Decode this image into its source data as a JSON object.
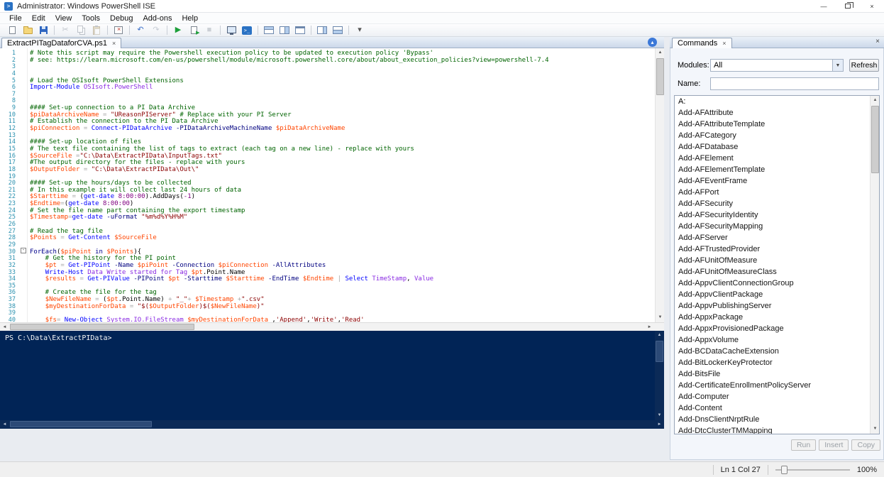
{
  "window": {
    "title": "Administrator: Windows PowerShell ISE",
    "controls": {
      "minimize": "—",
      "close": "×"
    }
  },
  "menu": {
    "items": [
      "File",
      "Edit",
      "View",
      "Tools",
      "Debug",
      "Add-ons",
      "Help"
    ]
  },
  "toolbar": {
    "groups": [
      [
        {
          "name": "new-script",
          "type": "doc"
        },
        {
          "name": "open-script",
          "type": "folder"
        },
        {
          "name": "save-script",
          "type": "floppy"
        }
      ],
      [
        {
          "name": "cut",
          "glyph": "✂",
          "color": "#7d8691",
          "disabled": true
        },
        {
          "name": "copy",
          "type": "copy",
          "disabled": true
        },
        {
          "name": "paste",
          "type": "paste",
          "disabled": true
        }
      ],
      [
        {
          "name": "clear-console-pane",
          "type": "clear"
        }
      ],
      [
        {
          "name": "undo",
          "glyph": "↶",
          "color": "#3a6fc9"
        },
        {
          "name": "redo",
          "glyph": "↷",
          "color": "#8a97a8",
          "disabled": true
        }
      ],
      [
        {
          "name": "run-script",
          "glyph": "▶",
          "color": "#1d9f3a"
        },
        {
          "name": "run-selection",
          "type": "runsel"
        },
        {
          "name": "stop-operation",
          "glyph": "■",
          "color": "#9aa2ab",
          "disabled": true
        }
      ],
      [
        {
          "name": "new-remote-powershell-tab",
          "type": "monitor"
        },
        {
          "name": "start-powershell-exe",
          "type": "psbadge"
        }
      ],
      [
        {
          "name": "show-script-pane-top",
          "type": "pane-top"
        },
        {
          "name": "show-script-pane-right",
          "type": "pane-right"
        },
        {
          "name": "show-script-pane-maximized",
          "type": "pane-max"
        }
      ],
      [
        {
          "name": "show-command-addon",
          "type": "pane-addon"
        },
        {
          "name": "show-console-pane",
          "type": "pane-bottom"
        }
      ],
      [
        {
          "name": "toolbar-overflow",
          "glyph": "▾",
          "color": "#555555"
        }
      ]
    ]
  },
  "editor": {
    "tab_label": "ExtractPITagDataforCVA.ps1",
    "tab_close": "×",
    "collapse_glyph": "▴",
    "fold_line": 30,
    "lines": [
      [
        [
          "cmt",
          "# Note this script may require the Powershell execution policy to be updated to execution policy 'Bypass'"
        ]
      ],
      [
        [
          "cmt",
          "# see: https://learn.microsoft.com/en-us/powershell/module/microsoft.powershell.core/about/about_execution_policies?view=powershell-7.4"
        ]
      ],
      [],
      [],
      [
        [
          "cmt",
          "# Load the OSIsoft PowerShell Extensions"
        ]
      ],
      [
        [
          "cmd",
          "Import-Module"
        ],
        [
          "arg",
          " OSIsoft.PowerShell"
        ]
      ],
      [],
      [],
      [
        [
          "cmt",
          "#### Set-up connection to a PI Data Archive"
        ]
      ],
      [
        [
          "var",
          "$piDataArchiveName"
        ],
        [
          "plain",
          " "
        ],
        [
          "op",
          "="
        ],
        [
          "plain",
          " "
        ],
        [
          "str",
          "\"UReasonPIServer\""
        ],
        [
          "plain",
          " "
        ],
        [
          "cmt",
          "# Replace with your PI Server"
        ]
      ],
      [
        [
          "cmt",
          "# Establish the connection to the PI Data Archive"
        ]
      ],
      [
        [
          "var",
          "$piConnection"
        ],
        [
          "plain",
          " "
        ],
        [
          "op",
          "="
        ],
        [
          "plain",
          " "
        ],
        [
          "cmd",
          "Connect-PIDataArchive"
        ],
        [
          "plain",
          " "
        ],
        [
          "param",
          "-PIDataArchiveMachineName"
        ],
        [
          "plain",
          " "
        ],
        [
          "var",
          "$piDataArchiveName"
        ]
      ],
      [],
      [
        [
          "cmt",
          "#### Set-up location of files"
        ]
      ],
      [
        [
          "cmt",
          "# The text file containing the list of tags to extract (each tag on a new line) - replace with yours"
        ]
      ],
      [
        [
          "var",
          "$SourceFile"
        ],
        [
          "plain",
          " "
        ],
        [
          "op",
          "="
        ],
        [
          "str",
          "\"C:\\Data\\ExtractPIData\\InputTags.txt\""
        ]
      ],
      [
        [
          "cmt",
          "#The output directory for the files - replace with yours"
        ]
      ],
      [
        [
          "var",
          "$OutputFolder"
        ],
        [
          "plain",
          " "
        ],
        [
          "op",
          "="
        ],
        [
          "plain",
          " "
        ],
        [
          "str",
          "\"C:\\Data\\ExtractPIData\\Out\\\""
        ]
      ],
      [],
      [
        [
          "cmt",
          "#### Set-up the hours/days to be collected"
        ]
      ],
      [
        [
          "cmt",
          "# In this example it will collect last 24 hours of data"
        ]
      ],
      [
        [
          "var",
          "$Starttime"
        ],
        [
          "plain",
          " "
        ],
        [
          "op",
          "="
        ],
        [
          "plain",
          " ("
        ],
        [
          "cmd",
          "get-date"
        ],
        [
          "plain",
          " "
        ],
        [
          "num",
          "8:00:00"
        ],
        [
          "plain",
          ")."
        ],
        [
          "mem",
          "AddDays"
        ],
        [
          "plain",
          "("
        ],
        [
          "num",
          "-1"
        ],
        [
          "plain",
          ")"
        ]
      ],
      [
        [
          "var",
          "$Endtime"
        ],
        [
          "op",
          "="
        ],
        [
          "plain",
          "("
        ],
        [
          "cmd",
          "get-date"
        ],
        [
          "plain",
          " "
        ],
        [
          "num",
          "8:00:00"
        ],
        [
          "plain",
          ")"
        ]
      ],
      [
        [
          "cmt",
          "# Set the file name part containing the export timestamp"
        ]
      ],
      [
        [
          "var",
          "$Timestamp"
        ],
        [
          "op",
          "="
        ],
        [
          "cmd",
          "get-date"
        ],
        [
          "plain",
          " "
        ],
        [
          "param",
          "-uFormat"
        ],
        [
          "plain",
          " "
        ],
        [
          "str",
          "\"%m%d%Y%H%M\""
        ]
      ],
      [],
      [
        [
          "cmt",
          "# Read the tag file"
        ]
      ],
      [
        [
          "var",
          "$Points"
        ],
        [
          "plain",
          " "
        ],
        [
          "op",
          "="
        ],
        [
          "plain",
          " "
        ],
        [
          "cmd",
          "Get-Content"
        ],
        [
          "plain",
          " "
        ],
        [
          "var",
          "$SourceFile"
        ]
      ],
      [],
      [
        [
          "kw",
          "ForEach"
        ],
        [
          "plain",
          "("
        ],
        [
          "var",
          "$piPoint"
        ],
        [
          "plain",
          " "
        ],
        [
          "kw",
          "in"
        ],
        [
          "plain",
          " "
        ],
        [
          "var",
          "$Points"
        ],
        [
          "plain",
          "){"
        ]
      ],
      [
        [
          "cmt",
          "    # Get the history for the PI point"
        ]
      ],
      [
        [
          "plain",
          "    "
        ],
        [
          "var",
          "$pt"
        ],
        [
          "plain",
          " "
        ],
        [
          "op",
          "="
        ],
        [
          "plain",
          " "
        ],
        [
          "cmd",
          "Get-PIPoint"
        ],
        [
          "plain",
          " "
        ],
        [
          "param",
          "-Name"
        ],
        [
          "plain",
          " "
        ],
        [
          "var",
          "$piPoint"
        ],
        [
          "plain",
          " "
        ],
        [
          "param",
          "-Connection"
        ],
        [
          "plain",
          " "
        ],
        [
          "var",
          "$piConnection"
        ],
        [
          "plain",
          " "
        ],
        [
          "param",
          "-AllAttributes"
        ]
      ],
      [
        [
          "plain",
          "    "
        ],
        [
          "cmd",
          "Write-Host"
        ],
        [
          "arg",
          " Data Write started for Tag "
        ],
        [
          "var",
          "$pt"
        ],
        [
          "plain",
          "."
        ],
        [
          "mem",
          "Point"
        ],
        [
          "plain",
          "."
        ],
        [
          "mem",
          "Name"
        ]
      ],
      [
        [
          "plain",
          "    "
        ],
        [
          "var",
          "$results"
        ],
        [
          "plain",
          " "
        ],
        [
          "op",
          "="
        ],
        [
          "plain",
          " "
        ],
        [
          "cmd",
          "Get-PIValue"
        ],
        [
          "plain",
          " "
        ],
        [
          "param",
          "-PIPoint"
        ],
        [
          "plain",
          " "
        ],
        [
          "var",
          "$pt"
        ],
        [
          "plain",
          " "
        ],
        [
          "param",
          "-Starttime"
        ],
        [
          "plain",
          " "
        ],
        [
          "var",
          "$Starttime"
        ],
        [
          "plain",
          " "
        ],
        [
          "param",
          "-EndTime"
        ],
        [
          "plain",
          " "
        ],
        [
          "var",
          "$Endtime"
        ],
        [
          "plain",
          " "
        ],
        [
          "op",
          "|"
        ],
        [
          "plain",
          " "
        ],
        [
          "cmd",
          "Select"
        ],
        [
          "arg",
          " TimeStamp"
        ],
        [
          "plain",
          ","
        ],
        [
          "arg",
          " Value"
        ]
      ],
      [],
      [
        [
          "cmt",
          "    # Create the file for the tag"
        ]
      ],
      [
        [
          "plain",
          "    "
        ],
        [
          "var",
          "$NewFileName"
        ],
        [
          "plain",
          " "
        ],
        [
          "op",
          "="
        ],
        [
          "plain",
          " ("
        ],
        [
          "var",
          "$pt"
        ],
        [
          "plain",
          "."
        ],
        [
          "mem",
          "Point"
        ],
        [
          "plain",
          "."
        ],
        [
          "mem",
          "Name"
        ],
        [
          "plain",
          ") "
        ],
        [
          "op",
          "+"
        ],
        [
          "plain",
          " "
        ],
        [
          "str",
          "\"_\""
        ],
        [
          "op",
          "+"
        ],
        [
          "plain",
          " "
        ],
        [
          "var",
          "$Timestamp"
        ],
        [
          "plain",
          " "
        ],
        [
          "op",
          "+"
        ],
        [
          "str",
          "\".csv\""
        ]
      ],
      [
        [
          "plain",
          "    "
        ],
        [
          "var",
          "$myDestinationForData"
        ],
        [
          "plain",
          " "
        ],
        [
          "op",
          "="
        ],
        [
          "plain",
          " "
        ],
        [
          "str",
          "\"$("
        ],
        [
          "var",
          "$OutputFolder"
        ],
        [
          "str",
          ")$("
        ],
        [
          "var",
          "$NewFileName"
        ],
        [
          "str",
          ")\""
        ]
      ],
      [],
      [
        [
          "plain",
          "    "
        ],
        [
          "var",
          "$fs"
        ],
        [
          "op",
          "="
        ],
        [
          "plain",
          " "
        ],
        [
          "cmd",
          "New-Object"
        ],
        [
          "plain",
          " "
        ],
        [
          "arg",
          "System.IO.FileStream"
        ],
        [
          "plain",
          " "
        ],
        [
          "var",
          "$myDestinationForData"
        ],
        [
          "plain",
          " ,"
        ],
        [
          "str",
          "'Append'"
        ],
        [
          "plain",
          ","
        ],
        [
          "str",
          "'Write'"
        ],
        [
          "plain",
          ","
        ],
        [
          "str",
          "'Read'"
        ]
      ]
    ]
  },
  "console": {
    "prompt": "PS C:\\Data\\ExtractPIData>"
  },
  "commands_panel": {
    "tab_label": "Commands",
    "tab_close": "×",
    "pane_close": "×",
    "modules_label": "Modules:",
    "modules_value": "All",
    "refresh_button": "Refresh",
    "name_label": "Name:",
    "name_value": "",
    "list_header": "A:",
    "commands": [
      "Add-AFAttribute",
      "Add-AFAttributeTemplate",
      "Add-AFCategory",
      "Add-AFDatabase",
      "Add-AFElement",
      "Add-AFElementTemplate",
      "Add-AFEventFrame",
      "Add-AFPort",
      "Add-AFSecurity",
      "Add-AFSecurityIdentity",
      "Add-AFSecurityMapping",
      "Add-AFServer",
      "Add-AFTrustedProvider",
      "Add-AFUnitOfMeasure",
      "Add-AFUnitOfMeasureClass",
      "Add-AppvClientConnectionGroup",
      "Add-AppvClientPackage",
      "Add-AppvPublishingServer",
      "Add-AppxPackage",
      "Add-AppxProvisionedPackage",
      "Add-AppxVolume",
      "Add-BCDataCacheExtension",
      "Add-BitLockerKeyProtector",
      "Add-BitsFile",
      "Add-CertificateEnrollmentPolicyServer",
      "Add-Computer",
      "Add-Content",
      "Add-DnsClientNrptRule",
      "Add-DtcClusterTMMapping"
    ],
    "buttons": [
      "Run",
      "Insert",
      "Copy"
    ]
  },
  "status_bar": {
    "position": "Ln 1 Col 27",
    "zoom": "100%"
  },
  "colors": {
    "console_bg": "#012456",
    "comment": "#006400",
    "variable": "#ff4500",
    "string": "#8b0000",
    "command": "#0000ff",
    "keyword": "#00008b"
  }
}
